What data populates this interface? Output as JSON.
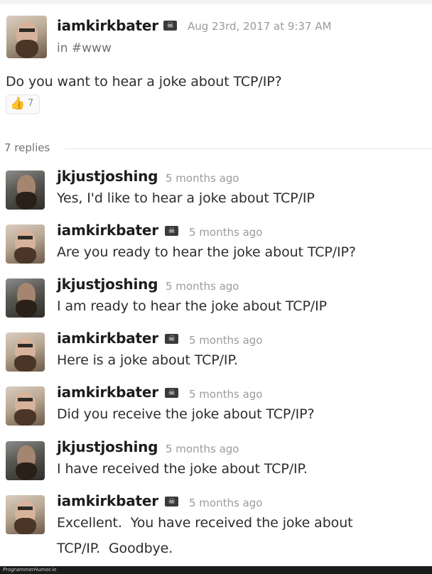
{
  "post": {
    "username": "iamkirkbater",
    "badge": "☠",
    "timestamp": "Aug 23rd, 2017 at 9:37 AM",
    "channel": "in #www",
    "text": "Do you want to hear a joke about TCP/IP?",
    "reaction": {
      "icon": "thumbs-up-icon",
      "count": "7"
    }
  },
  "thread": {
    "replies_label": "7 replies",
    "replies": [
      {
        "username": "jkjustjoshing",
        "time": "5 months ago",
        "text": "Yes, I'd like to hear a joke about TCP/IP",
        "badge": ""
      },
      {
        "username": "iamkirkbater",
        "time": "5 months ago",
        "text": "Are you ready to hear the joke about TCP/IP?",
        "badge": "☠"
      },
      {
        "username": "jkjustjoshing",
        "time": "5 months ago",
        "text": "I am ready to hear the joke about TCP/IP",
        "badge": ""
      },
      {
        "username": "iamkirkbater",
        "time": "5 months ago",
        "text": "Here is a joke about TCP/IP.",
        "badge": "☠"
      },
      {
        "username": "iamkirkbater",
        "time": "5 months ago",
        "text": "Did you receive the joke about TCP/IP?",
        "badge": "☠"
      },
      {
        "username": "jkjustjoshing",
        "time": "5 months ago",
        "text": "I have received the joke about TCP/IP.",
        "badge": ""
      },
      {
        "username": "iamkirkbater",
        "time": "5 months ago",
        "text": "Excellent.  You have received the joke about",
        "text2": "TCP/IP.  Goodbye.",
        "badge": "☠"
      }
    ]
  },
  "footer": {
    "watermark": "ProgrammerHumor.io"
  }
}
